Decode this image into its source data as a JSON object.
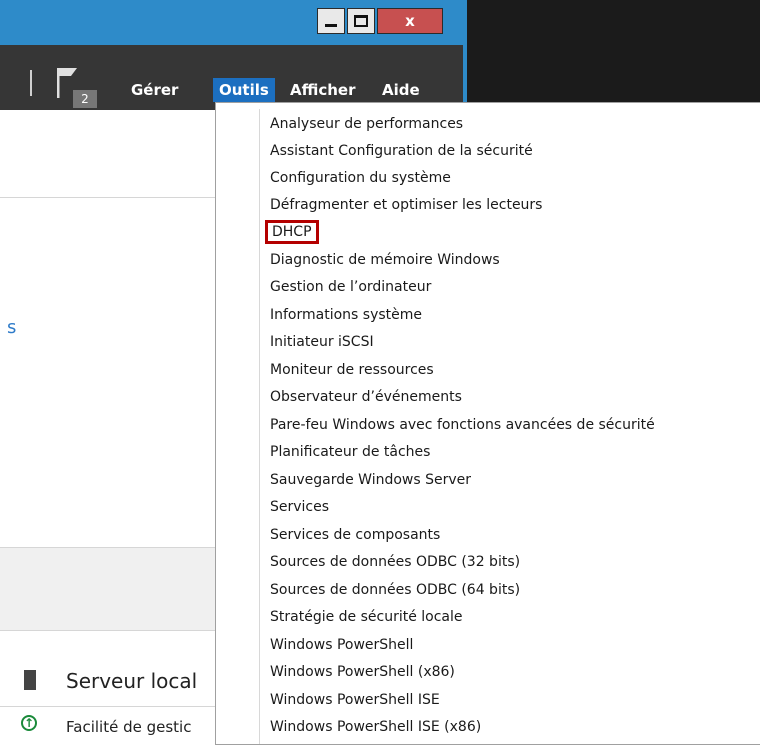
{
  "toolbar": {
    "notification_count": "2",
    "menu": [
      "Gérer",
      "Outils",
      "Afficher",
      "Aide"
    ],
    "active_menu": "Outils"
  },
  "window_controls": {
    "close_label": "x"
  },
  "background": {
    "status_fragment": "s",
    "server_label": "Serveur local",
    "facility_label": "Facilité de gestic"
  },
  "tools_menu": {
    "items": [
      "Analyseur de performances",
      "Assistant Configuration de la sécurité",
      "Configuration du système",
      "Défragmenter et optimiser les lecteurs",
      "DHCP",
      "Diagnostic de mémoire Windows",
      "Gestion de l’ordinateur",
      "Informations système",
      "Initiateur iSCSI",
      "Moniteur de ressources",
      "Observateur d’événements",
      "Pare-feu Windows avec fonctions avancées de sécurité",
      "Planificateur de tâches",
      "Sauvegarde Windows Server",
      "Services",
      "Services de composants",
      "Sources de données ODBC (32 bits)",
      "Sources de données ODBC (64 bits)",
      "Stratégie de sécurité locale",
      "Windows PowerShell",
      "Windows PowerShell (x86)",
      "Windows PowerShell ISE",
      "Windows PowerShell ISE (x86)"
    ],
    "highlighted_item": "DHCP"
  },
  "colors": {
    "accent_blue": "#2e8bc9",
    "active_menu_bg": "#1c6fc0",
    "highlight_border": "#b40000",
    "menubar_bg": "#363636"
  }
}
